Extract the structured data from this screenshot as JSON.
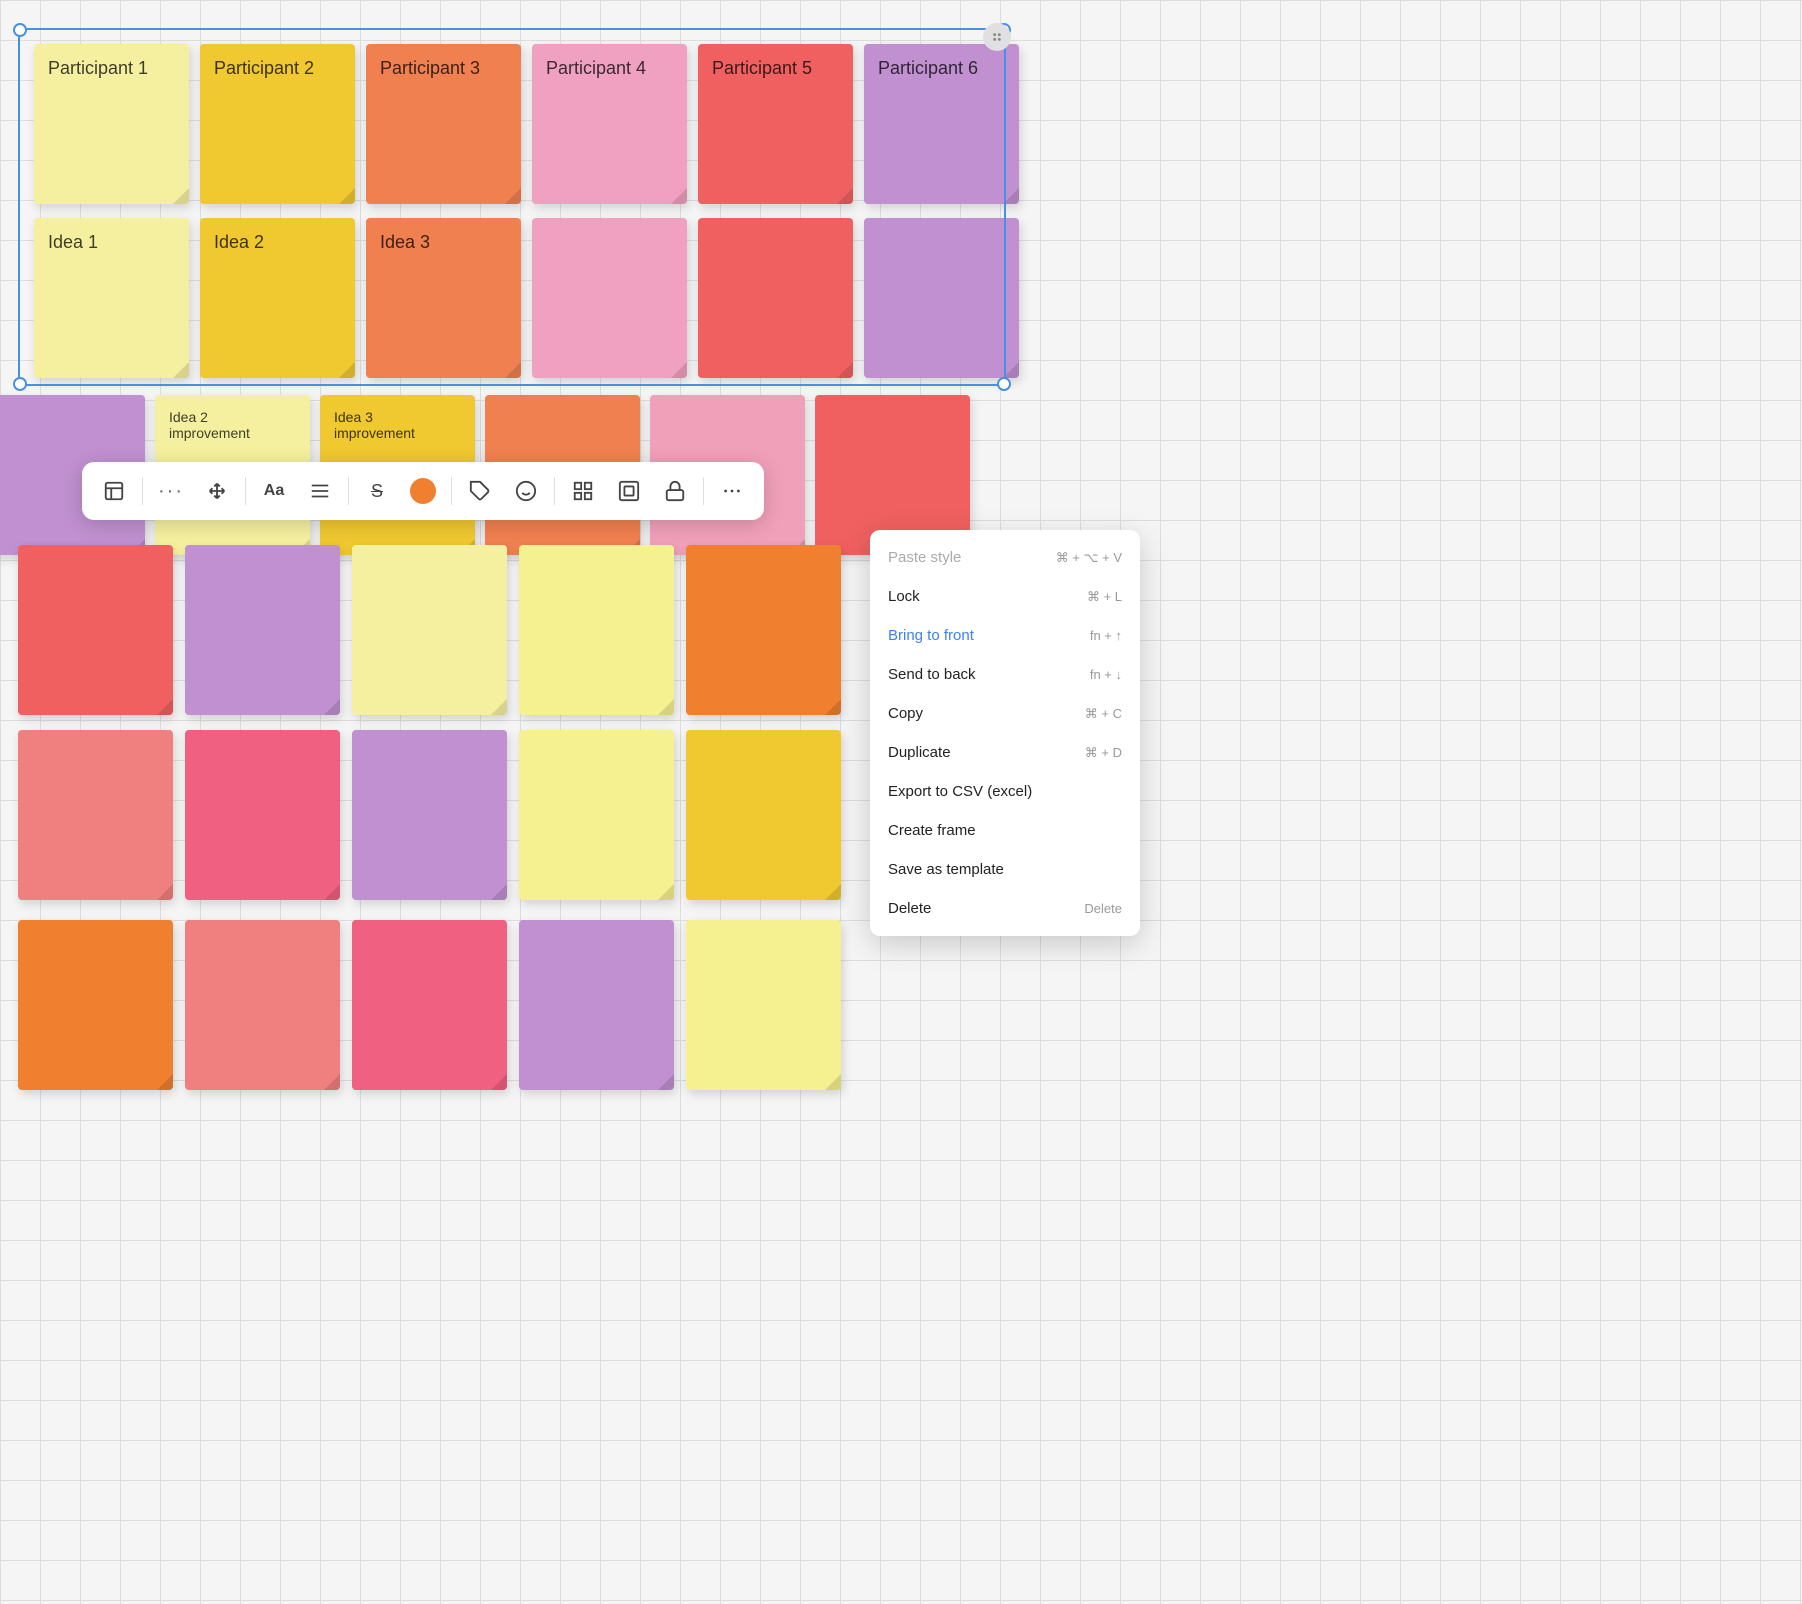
{
  "canvas": {
    "background": "#f5f5f5"
  },
  "stickies": {
    "row1": [
      {
        "id": "p1",
        "label": "Participant 1",
        "color": "#f5f0a0"
      },
      {
        "id": "p2",
        "label": "Participant 2",
        "color": "#f0c830"
      },
      {
        "id": "p3",
        "label": "Participant 3",
        "color": "#f08050"
      },
      {
        "id": "p4",
        "label": "Participant 4",
        "color": "#f0a0c0"
      },
      {
        "id": "p5",
        "label": "Participant 5",
        "color": "#f06060"
      },
      {
        "id": "p6",
        "label": "Participant 6",
        "color": "#c090d0"
      }
    ],
    "row2": [
      {
        "id": "i1",
        "label": "Idea 1",
        "color": "#f5f0a0"
      },
      {
        "id": "i2",
        "label": "Idea 2",
        "color": "#f0c830"
      },
      {
        "id": "i3",
        "label": "Idea 3",
        "color": "#f08050"
      },
      {
        "id": "i4",
        "label": "",
        "color": "#f0a0c0"
      },
      {
        "id": "i5",
        "label": "",
        "color": "#f06060"
      },
      {
        "id": "i6",
        "label": "",
        "color": "#c090d0"
      }
    ],
    "row3": [
      {
        "id": "r3-2",
        "label": "Idea 2 improvement",
        "color": "#f5f0a0"
      },
      {
        "id": "r3-3",
        "label": "Idea 3 improvement",
        "color": "#f0c830"
      }
    ]
  },
  "toolbar": {
    "buttons": [
      {
        "id": "sticky",
        "icon": "sticky-note",
        "label": "Sticky note"
      },
      {
        "id": "more",
        "icon": "ellipsis",
        "label": "More"
      },
      {
        "id": "move",
        "icon": "move",
        "label": "Move"
      },
      {
        "id": "font",
        "icon": "Aa",
        "label": "Font"
      },
      {
        "id": "align",
        "icon": "align",
        "label": "Align"
      },
      {
        "id": "strikethrough",
        "icon": "S",
        "label": "Strikethrough"
      },
      {
        "id": "color",
        "icon": "color",
        "label": "Color"
      },
      {
        "id": "tag",
        "icon": "tag",
        "label": "Tag"
      },
      {
        "id": "emoji",
        "icon": "emoji",
        "label": "Emoji"
      },
      {
        "id": "frame",
        "icon": "frame",
        "label": "Frame"
      },
      {
        "id": "contain",
        "icon": "contain",
        "label": "Contain"
      },
      {
        "id": "lock",
        "icon": "lock",
        "label": "Lock"
      },
      {
        "id": "more2",
        "icon": "ellipsis",
        "label": "More options"
      }
    ]
  },
  "context_menu": {
    "items": [
      {
        "id": "paste-style",
        "label": "Paste style",
        "shortcut": "⌘ + ⌥ + V",
        "active": false,
        "disabled": true
      },
      {
        "id": "lock",
        "label": "Lock",
        "shortcut": "⌘ + L",
        "active": false
      },
      {
        "id": "bring-to-front",
        "label": "Bring to front",
        "shortcut": "fn + ↑",
        "active": true
      },
      {
        "id": "send-to-back",
        "label": "Send to back",
        "shortcut": "fn + ↓",
        "active": false
      },
      {
        "id": "copy",
        "label": "Copy",
        "shortcut": "⌘ + C",
        "active": false
      },
      {
        "id": "duplicate",
        "label": "Duplicate",
        "shortcut": "⌘ + D",
        "active": false
      },
      {
        "id": "export-csv",
        "label": "Export to CSV (excel)",
        "shortcut": "",
        "active": false
      },
      {
        "id": "create-frame",
        "label": "Create frame",
        "shortcut": "",
        "active": false
      },
      {
        "id": "save-template",
        "label": "Save as template",
        "shortcut": "",
        "active": false
      },
      {
        "id": "delete",
        "label": "Delete",
        "shortcut": "Delete",
        "active": false
      }
    ]
  }
}
